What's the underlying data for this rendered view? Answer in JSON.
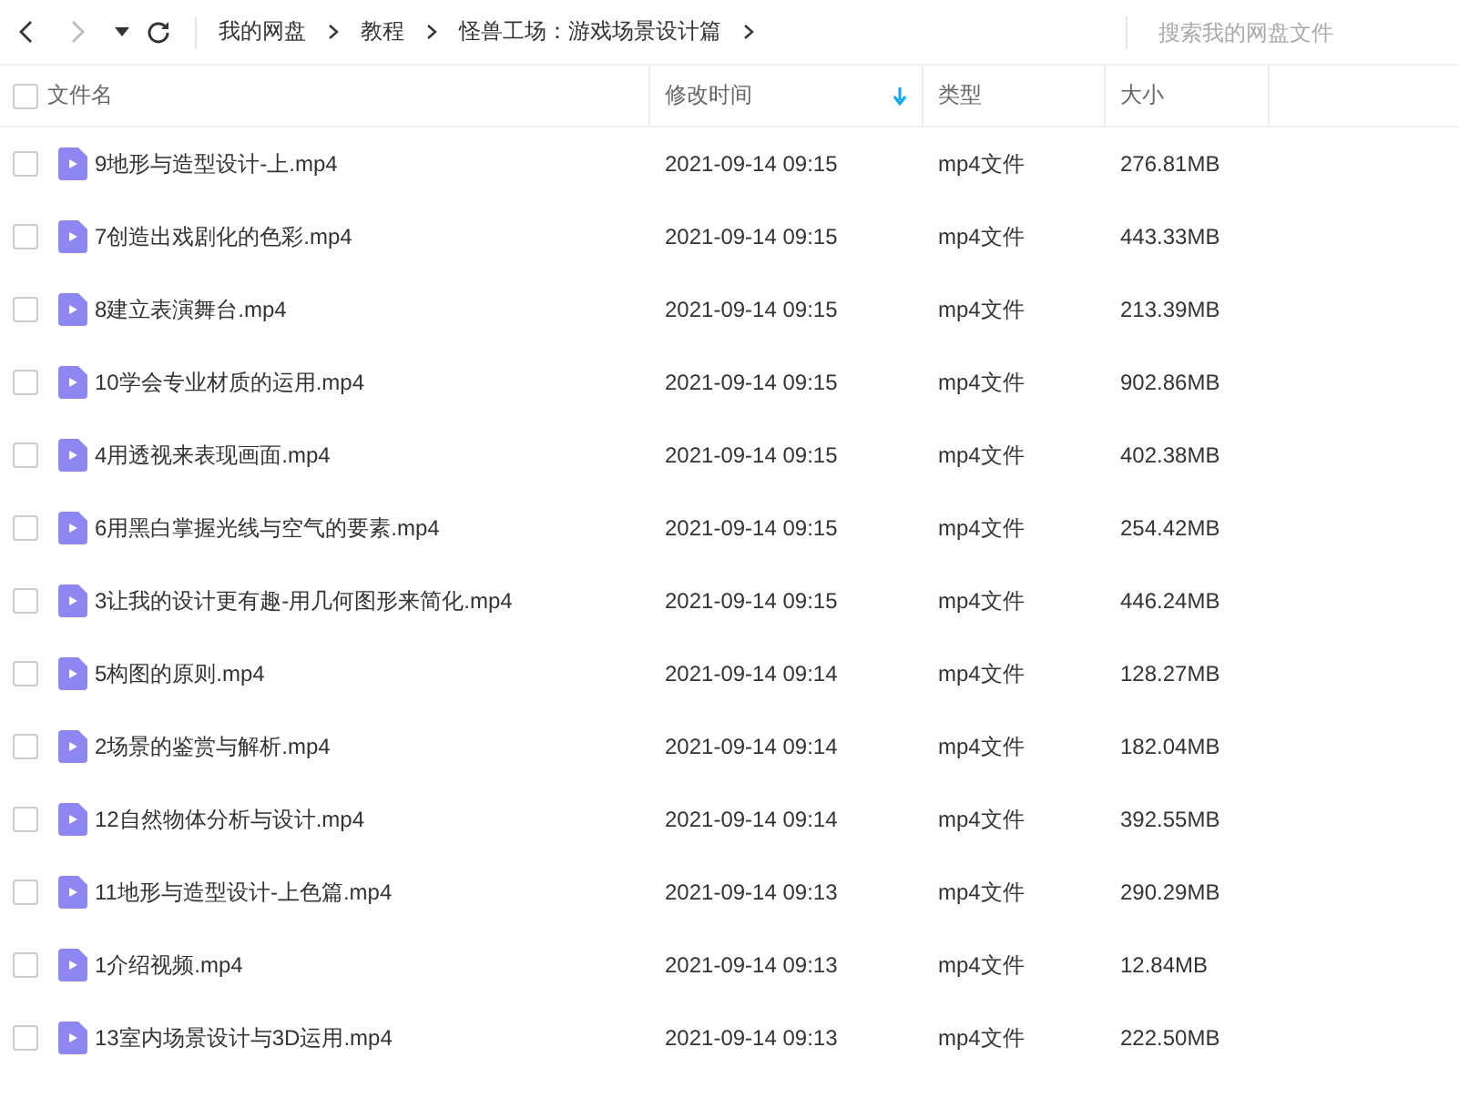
{
  "breadcrumbs": [
    "我的网盘",
    "教程",
    "怪兽工场：游戏场景设计篇"
  ],
  "search": {
    "placeholder": "搜索我的网盘文件"
  },
  "select_all": {
    "checked": false
  },
  "columns": [
    {
      "label": "文件名",
      "sorted": false
    },
    {
      "label": "修改时间",
      "sorted": true
    },
    {
      "label": "类型",
      "sorted": false
    },
    {
      "label": "大小",
      "sorted": false
    }
  ],
  "rows": [
    {
      "name": "9地形与造型设计-上.mp4",
      "time": "2021-09-14 09:15",
      "type": "mp4文件",
      "size": "276.81MB",
      "checked": false
    },
    {
      "name": "7创造出戏剧化的色彩.mp4",
      "time": "2021-09-14 09:15",
      "type": "mp4文件",
      "size": "443.33MB",
      "checked": false
    },
    {
      "name": "8建立表演舞台.mp4",
      "time": "2021-09-14 09:15",
      "type": "mp4文件",
      "size": "213.39MB",
      "checked": false
    },
    {
      "name": "10学会专业材质的运用.mp4",
      "time": "2021-09-14 09:15",
      "type": "mp4文件",
      "size": "902.86MB",
      "checked": false
    },
    {
      "name": "4用透视来表现画面.mp4",
      "time": "2021-09-14 09:15",
      "type": "mp4文件",
      "size": "402.38MB",
      "checked": false
    },
    {
      "name": "6用黑白掌握光线与空气的要素.mp4",
      "time": "2021-09-14 09:15",
      "type": "mp4文件",
      "size": "254.42MB",
      "checked": false
    },
    {
      "name": "3让我的设计更有趣-用几何图形来简化.mp4",
      "time": "2021-09-14 09:15",
      "type": "mp4文件",
      "size": "446.24MB",
      "checked": false
    },
    {
      "name": "5构图的原则.mp4",
      "time": "2021-09-14 09:14",
      "type": "mp4文件",
      "size": "128.27MB",
      "checked": false
    },
    {
      "name": "2场景的鉴赏与解析.mp4",
      "time": "2021-09-14 09:14",
      "type": "mp4文件",
      "size": "182.04MB",
      "checked": false
    },
    {
      "name": "12自然物体分析与设计.mp4",
      "time": "2021-09-14 09:14",
      "type": "mp4文件",
      "size": "392.55MB",
      "checked": false
    },
    {
      "name": "11地形与造型设计-上色篇.mp4",
      "time": "2021-09-14 09:13",
      "type": "mp4文件",
      "size": "290.29MB",
      "checked": false
    },
    {
      "name": "1介绍视频.mp4",
      "time": "2021-09-14 09:13",
      "type": "mp4文件",
      "size": "12.84MB",
      "checked": false
    },
    {
      "name": "13室内场景设计与3D运用.mp4",
      "time": "2021-09-14 09:13",
      "type": "mp4文件",
      "size": "222.50MB",
      "checked": false
    }
  ]
}
